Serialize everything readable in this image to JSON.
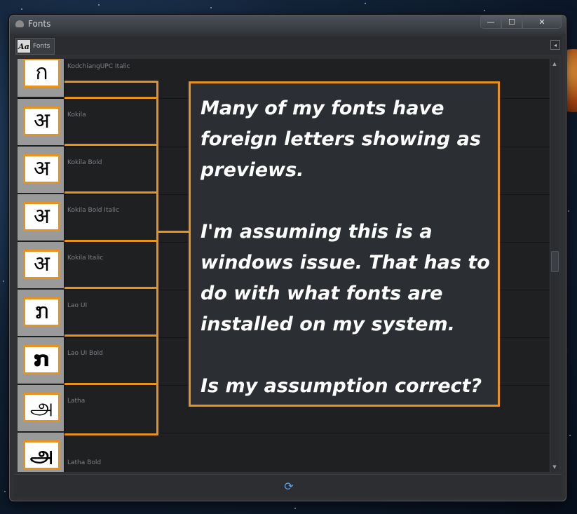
{
  "window": {
    "title": "Fonts"
  },
  "window_buttons": {
    "minimize": "—",
    "maximize": "☐",
    "close": "✕"
  },
  "tab": {
    "icon_text": "Aa",
    "label": "Fonts",
    "menu_icon": "◂"
  },
  "fonts": [
    {
      "name": "KodchiangUPC Italic",
      "preview": "ก"
    },
    {
      "name": "Kokila",
      "preview": "अ"
    },
    {
      "name": "Kokila Bold",
      "preview": "अ"
    },
    {
      "name": "Kokila Bold Italic",
      "preview": "अ"
    },
    {
      "name": "Kokila Italic",
      "preview": "अ"
    },
    {
      "name": "Lao UI",
      "preview": "ກ"
    },
    {
      "name": "Lao UI Bold",
      "preview": "ກ"
    },
    {
      "name": "Latha",
      "preview": "அ"
    },
    {
      "name": "Latha Bold",
      "preview": "அ"
    }
  ],
  "scrollbar": {
    "up_arrow": "▲",
    "down_arrow": "▼"
  },
  "footer": {
    "refresh_icon": "⟳"
  },
  "callout": {
    "line1": "Many of my fonts have",
    "line2": "foreign letters showing as",
    "line3": "previews.",
    "line4": "I'm assuming this is a",
    "line5": "windows issue. That has to",
    "line6": "do with what fonts are",
    "line7": "installed on my system.",
    "line8": "Is my assumption correct?"
  },
  "colors": {
    "accent": "#e8911d",
    "panel": "#1e2022",
    "callout_bg": "#2b2f33"
  }
}
